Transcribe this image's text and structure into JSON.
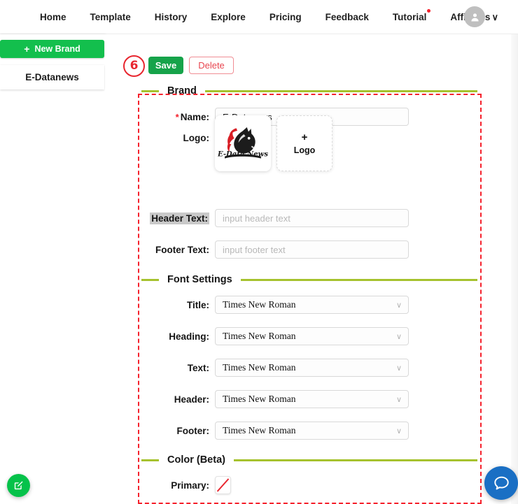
{
  "topnav": {
    "items": [
      {
        "label": "Home",
        "badge": false
      },
      {
        "label": "Template",
        "badge": false
      },
      {
        "label": "History",
        "badge": false
      },
      {
        "label": "Explore",
        "badge": false
      },
      {
        "label": "Pricing",
        "badge": false
      },
      {
        "label": "Feedback",
        "badge": false
      },
      {
        "label": "Tutorial",
        "badge": true
      },
      {
        "label": "Affiliates",
        "badge": false
      }
    ],
    "avatar_icon": "user-icon",
    "chevron": "∨"
  },
  "sidebar": {
    "new_brand_label": "New Brand",
    "new_brand_plus": "+",
    "brands": [
      {
        "name": "E-Datanews"
      }
    ]
  },
  "toolbar": {
    "step_badge": "6",
    "save_label": "Save",
    "delete_label": "Delete"
  },
  "sections": {
    "brand": "Brand",
    "font_settings": "Font Settings",
    "color": "Color (Beta)"
  },
  "brand_form": {
    "name_label": "Name:",
    "name_required": "*",
    "name_value": "E-Datanews",
    "logo_label": "Logo:",
    "logo_alt": "E-Data News horse mascot logo",
    "logo_add_plus": "+",
    "logo_add_label": "Logo",
    "header_text_label": "Header Text:",
    "header_text_value": "",
    "header_text_placeholder": "input header text",
    "footer_text_label": "Footer Text:",
    "footer_text_value": "",
    "footer_text_placeholder": "input footer text"
  },
  "font_settings": {
    "rows": [
      {
        "label": "Title:",
        "value": "Times New Roman"
      },
      {
        "label": "Heading:",
        "value": "Times New Roman"
      },
      {
        "label": "Text:",
        "value": "Times New Roman"
      },
      {
        "label": "Header:",
        "value": "Times New Roman"
      },
      {
        "label": "Footer:",
        "value": "Times New Roman"
      }
    ],
    "dropdown_arrow": "∨"
  },
  "color_section": {
    "primary_label": "Primary:",
    "primary_value": "none"
  },
  "floating": {
    "edit_icon": "edit-pencil-icon",
    "chat_icon": "chat-bubble-icon"
  },
  "colors": {
    "green_primary": "#13bf4d",
    "green_save": "#16a34a",
    "red_accent": "#f5222d",
    "olive_line": "#a6c22e",
    "blue_chat": "#1a6fc4"
  }
}
